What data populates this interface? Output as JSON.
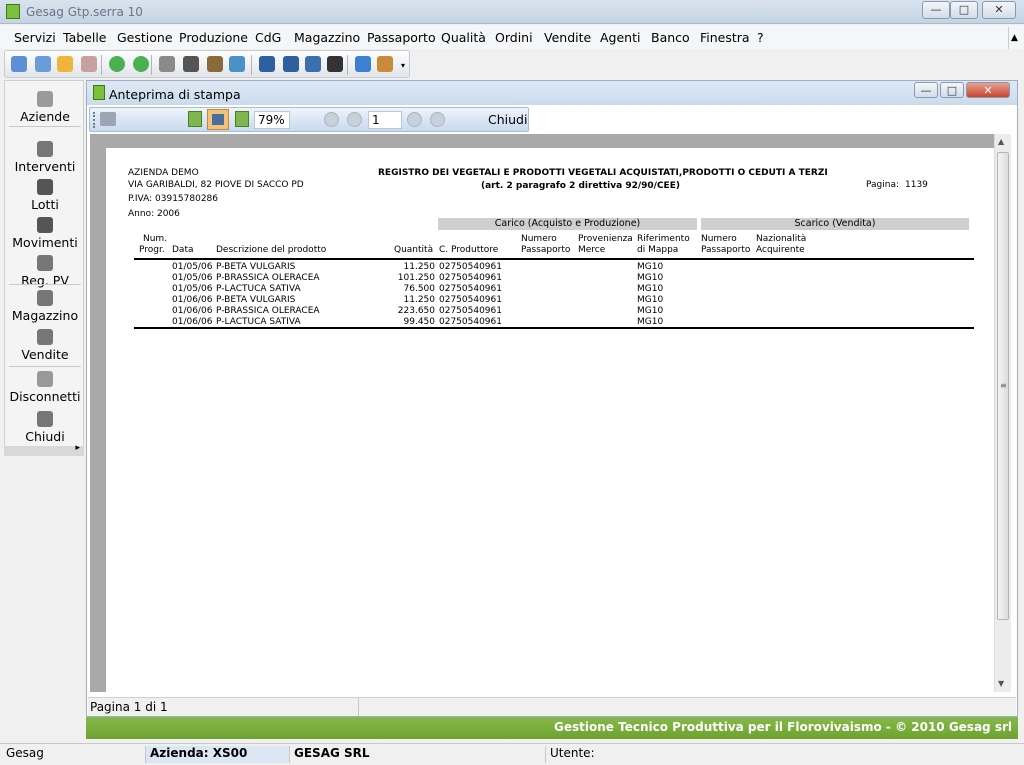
{
  "app": {
    "title": "Gesag Gtp.serra 10"
  },
  "menu": [
    "Servizi",
    "Tabelle",
    "Gestione",
    "Produzione",
    "CdG",
    "Magazzino",
    "Passaporto",
    "Qualità",
    "Ordini",
    "Vendite",
    "Agenti",
    "Banco",
    "Finestra",
    "?"
  ],
  "toolbar_icons": [
    "home-icon",
    "copy-icon",
    "folder-icon",
    "tag-icon",
    "back-icon",
    "forward-icon",
    "hand-icon",
    "print-icon",
    "truck-icon",
    "refresh-icon",
    "calendar-icon",
    "calendar2-icon",
    "report-icon",
    "link-icon",
    "info-icon",
    "user-icon"
  ],
  "leftnav": [
    {
      "label": "Aziende",
      "icon": "flower-icon"
    },
    {
      "label": "Interventi",
      "icon": "hand-icon"
    },
    {
      "label": "Lotti",
      "icon": "tray-icon"
    },
    {
      "label": "Movimenti",
      "icon": "swap-icon"
    },
    {
      "label": "Reg. PV",
      "icon": "printer-icon"
    },
    {
      "label": "Magazzino",
      "icon": "warehouse-icon"
    },
    {
      "label": "Vendite",
      "icon": "cashier-icon"
    },
    {
      "label": "Disconnetti",
      "icon": "keys-icon"
    },
    {
      "label": "Chiudi",
      "icon": "exit-icon"
    }
  ],
  "child": {
    "title": "Anteprima di stampa"
  },
  "preview_toolbar": {
    "zoom": "79%",
    "page": "1",
    "close_label": "Chiudi"
  },
  "report": {
    "company": "AZIENDA DEMO",
    "address": "VIA GARIBALDI, 82 PIOVE DI SACCO PD",
    "piva": "P.IVA: 03915780286",
    "anno": "Anno: 2006",
    "title": "REGISTRO DEI VEGETALI E PRODOTTI VEGETALI ACQUISTATI,PRODOTTI O CEDUTI  A TERZI",
    "subtitle": "(art. 2 paragrafo 2 direttiva 92/90/CEE)",
    "page_label": "Pagina:",
    "page_no": "1139",
    "band_carico": "Carico (Acquisto e Produzione)",
    "band_scarico": "Scarico (Vendita)",
    "headers": {
      "num1": "Num.",
      "num2": "Progr.",
      "data": "Data",
      "desc": "Descrizione del prodotto",
      "qty": "Quantità",
      "prod": "C. Produttore",
      "npass1": "Numero",
      "npass2": "Passaporto",
      "prov1": "Provenienza",
      "prov2": "Merce",
      "rif1": "Riferimento",
      "rif2": "di Mappa",
      "snum1": "Numero",
      "snum2": "Passaporto",
      "naz1": "Nazionalità",
      "naz2": "Acquirente"
    },
    "rows": [
      {
        "date": "01/05/06",
        "desc": "P-BETA VULGARIS",
        "qty": "11.250",
        "prod": "02750540961",
        "rif": "MG10"
      },
      {
        "date": "01/05/06",
        "desc": "P-BRASSICA OLERACEA",
        "qty": "101.250",
        "prod": "02750540961",
        "rif": "MG10"
      },
      {
        "date": "01/05/06",
        "desc": "P-LACTUCA SATIVA",
        "qty": "76.500",
        "prod": "02750540961",
        "rif": "MG10"
      },
      {
        "date": "01/06/06",
        "desc": "P-BETA VULGARIS",
        "qty": "11.250",
        "prod": "02750540961",
        "rif": "MG10"
      },
      {
        "date": "01/06/06",
        "desc": "P-BRASSICA OLERACEA",
        "qty": "223.650",
        "prod": "02750540961",
        "rif": "MG10"
      },
      {
        "date": "01/06/06",
        "desc": "P-LACTUCA SATIVA",
        "qty": "99.450",
        "prod": "02750540961",
        "rif": "MG10"
      }
    ]
  },
  "child_status": "Pagina 1 di 1",
  "banner": "Gestione Tecnico Produttiva per il Florovivaismo - © 2010 Gesag srl",
  "statusbar": {
    "app": "Gesag",
    "azienda": "Azienda: XS00",
    "company": "GESAG SRL",
    "utente": "Utente:"
  }
}
